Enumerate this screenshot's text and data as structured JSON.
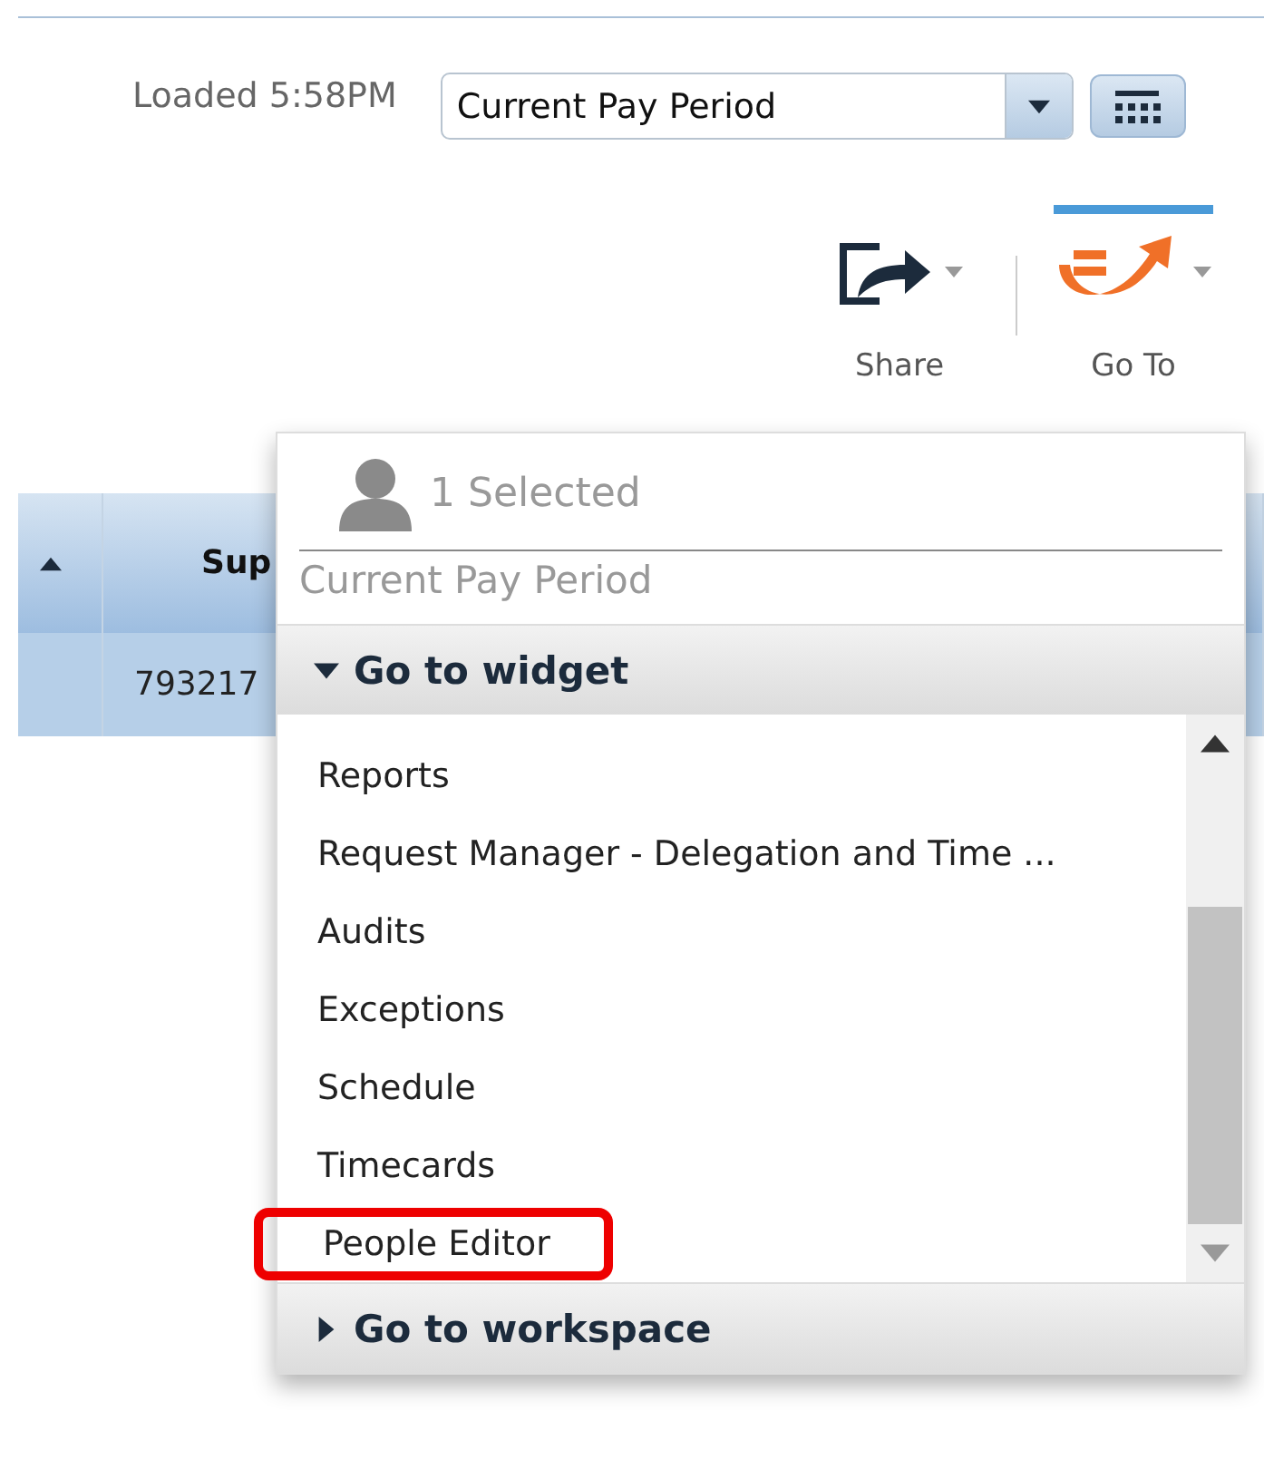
{
  "status": {
    "loaded": "Loaded 5:58PM"
  },
  "period_select": {
    "value": "Current Pay Period"
  },
  "actions": [
    {
      "label": "Share",
      "kind": "share",
      "selected": false
    },
    {
      "label": "Go To",
      "kind": "goto",
      "selected": true
    }
  ],
  "table": {
    "columns": [
      {
        "kind": "sort"
      },
      {
        "label": "Sup",
        "kind": "text"
      }
    ],
    "rows": [
      {
        "value": "793217"
      }
    ]
  },
  "popup": {
    "selection": "1 Selected",
    "context": "Current Pay Period",
    "sections": [
      {
        "title": "Go to widget",
        "expanded": true,
        "items": [
          {
            "label": "Reports",
            "highlighted": false
          },
          {
            "label": "Request Manager - Delegation and Time ...",
            "highlighted": false
          },
          {
            "label": "Audits",
            "highlighted": false
          },
          {
            "label": "Exceptions",
            "highlighted": false
          },
          {
            "label": "Schedule",
            "highlighted": false
          },
          {
            "label": "Timecards",
            "highlighted": false
          },
          {
            "label": "People Editor",
            "highlighted": true
          }
        ]
      },
      {
        "title": "Go to workspace",
        "expanded": false
      }
    ]
  }
}
